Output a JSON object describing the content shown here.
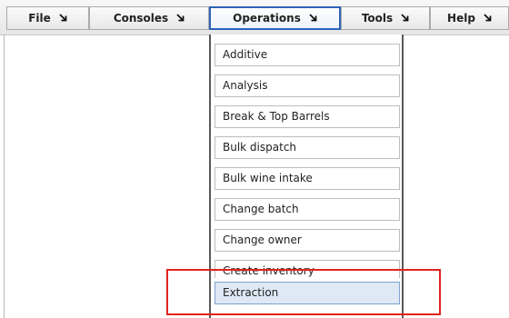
{
  "menubar": {
    "items": [
      {
        "label": "File",
        "icon": "arrow-down-right-icon"
      },
      {
        "label": "Consoles",
        "icon": "arrow-down-right-icon"
      },
      {
        "label": "Operations",
        "icon": "arrow-down-right-icon",
        "active": true
      },
      {
        "label": "Tools",
        "icon": "arrow-down-right-icon"
      },
      {
        "label": "Help",
        "icon": "arrow-down-right-icon"
      }
    ]
  },
  "operations_menu": {
    "items": [
      {
        "label": "Additive"
      },
      {
        "label": "Analysis"
      },
      {
        "label": "Break & Top Barrels"
      },
      {
        "label": "Bulk dispatch"
      },
      {
        "label": "Bulk wine intake"
      },
      {
        "label": "Change batch"
      },
      {
        "label": "Change owner"
      },
      {
        "label": "Create inventory"
      },
      {
        "label": "Extraction",
        "selected": true
      }
    ]
  },
  "colors": {
    "active_border": "#2f62b8",
    "selected_bg": "#dfe9f5",
    "highlight_box": "#e0241d"
  }
}
